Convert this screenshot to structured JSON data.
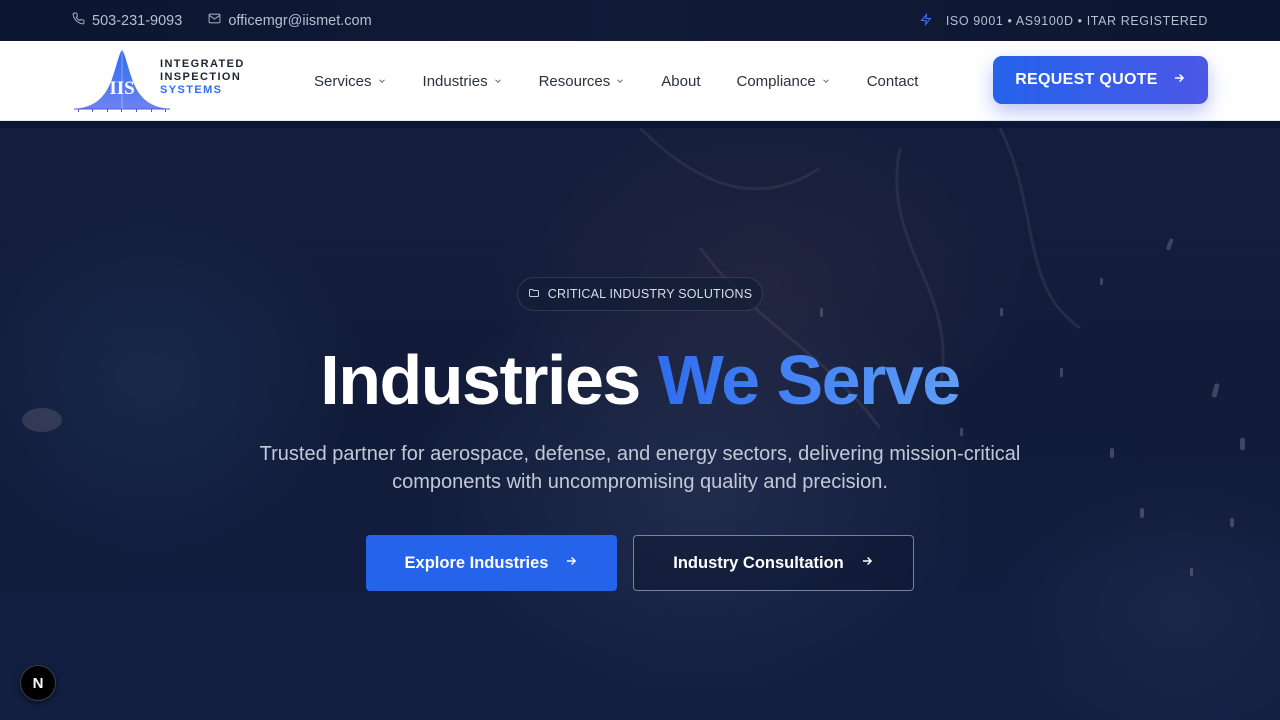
{
  "topbar": {
    "phone": "503-231-9093",
    "email": "officemgr@iismet.com",
    "certifications": "ISO 9001 • AS9100D • ITAR REGISTERED",
    "icons": {
      "phone": "phone-icon",
      "email": "mail-icon",
      "cert": "bolt-icon"
    }
  },
  "header": {
    "logo": {
      "mark_text": "IIS",
      "line1": "INTEGRATED",
      "line2": "INSPECTION",
      "line3": "SYSTEMS"
    },
    "nav": [
      {
        "label": "Services",
        "has_dropdown": true
      },
      {
        "label": "Industries",
        "has_dropdown": true
      },
      {
        "label": "Resources",
        "has_dropdown": true
      },
      {
        "label": "About",
        "has_dropdown": false
      },
      {
        "label": "Compliance",
        "has_dropdown": true
      },
      {
        "label": "Contact",
        "has_dropdown": false
      }
    ],
    "cta_label": "REQUEST QUOTE"
  },
  "hero": {
    "badge": "CRITICAL INDUSTRY SOLUTIONS",
    "title_part1": "Industries",
    "title_part2": "We Serve",
    "subtitle": "Trusted partner for aerospace, defense, and energy sectors, delivering mission-critical components with uncompromising quality and precision.",
    "primary_button": "Explore Industries",
    "secondary_button": "Industry Consultation"
  },
  "dev_badge": "N",
  "colors": {
    "accent": "#2563eb",
    "accent_light": "#5e9ef7",
    "topbar_bg": "#0c1630",
    "hero_bg": "#141f40"
  }
}
